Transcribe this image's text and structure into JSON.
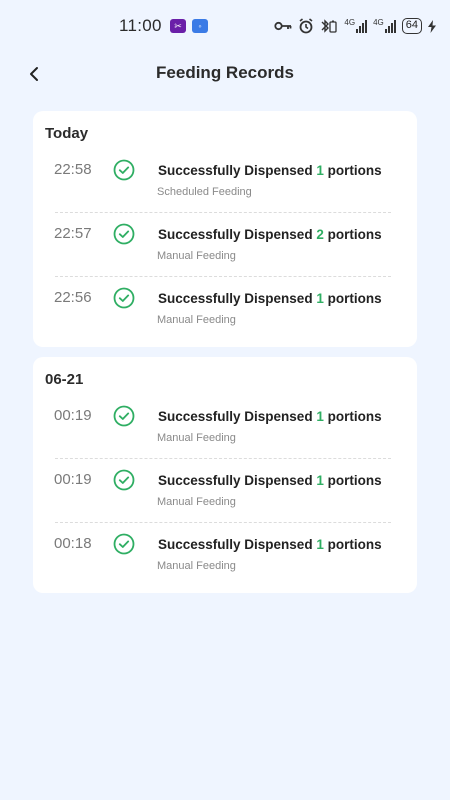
{
  "status_bar": {
    "time": "11:00",
    "battery": "64",
    "signal_label_1": "4G",
    "signal_label_2": "4G"
  },
  "header": {
    "title": "Feeding Records",
    "back_icon": "chevron-left-icon"
  },
  "colors": {
    "background": "#eff5ff",
    "accent_green": "#2fae63"
  },
  "groups": [
    {
      "date": "Today",
      "records": [
        {
          "time": "22:58",
          "prefix": "Successfully Dispensed",
          "portions": "1",
          "suffix": "portions",
          "type": "Scheduled Feeding"
        },
        {
          "time": "22:57",
          "prefix": "Successfully Dispensed",
          "portions": "2",
          "suffix": "portions",
          "type": "Manual Feeding"
        },
        {
          "time": "22:56",
          "prefix": "Successfully Dispensed",
          "portions": "1",
          "suffix": "portions",
          "type": "Manual Feeding"
        }
      ]
    },
    {
      "date": "06-21",
      "records": [
        {
          "time": "00:19",
          "prefix": "Successfully Dispensed",
          "portions": "1",
          "suffix": "portions",
          "type": "Manual Feeding"
        },
        {
          "time": "00:19",
          "prefix": "Successfully Dispensed",
          "portions": "1",
          "suffix": "portions",
          "type": "Manual Feeding"
        },
        {
          "time": "00:18",
          "prefix": "Successfully Dispensed",
          "portions": "1",
          "suffix": "portions",
          "type": "Manual Feeding"
        }
      ]
    }
  ]
}
